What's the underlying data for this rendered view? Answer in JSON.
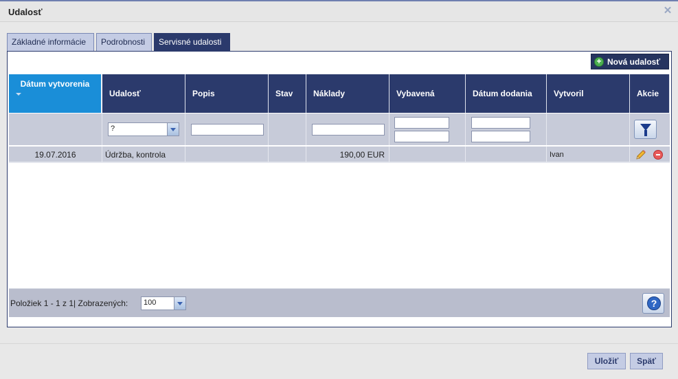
{
  "window": {
    "title": "Udalosť"
  },
  "tabs": [
    {
      "label": "Základné informácie"
    },
    {
      "label": "Podrobnosti"
    },
    {
      "label": "Servisné udalosti"
    }
  ],
  "toolbar": {
    "new_event_label": "Nová udalosť"
  },
  "grid": {
    "columns": [
      {
        "label": "Dátum vytvorenia",
        "sorted": true
      },
      {
        "label": "Udalosť"
      },
      {
        "label": "Popis"
      },
      {
        "label": "Stav"
      },
      {
        "label": "Náklady"
      },
      {
        "label": "Vybavená"
      },
      {
        "label": "Dátum dodania"
      },
      {
        "label": "Vytvoril"
      },
      {
        "label": "Akcie"
      }
    ],
    "filters": {
      "event_value": "?"
    },
    "rows": [
      {
        "date": "19.07.2016",
        "event": "Údržba, kontrola",
        "description": "",
        "status": "",
        "cost": "190,00 EUR",
        "resolved": "",
        "delivery_date": "",
        "created_by": "Ivan"
      }
    ]
  },
  "pager": {
    "info": "Položiek 1 - 1 z 1| Zobrazených:",
    "page_size": "100"
  },
  "actions": {
    "save_label": "Uložiť",
    "back_label": "Späť"
  },
  "colors": {
    "header_bg": "#2b3a6c",
    "sorted_header_bg": "#1a8ed8",
    "row_bg": "#c7cbd9"
  }
}
